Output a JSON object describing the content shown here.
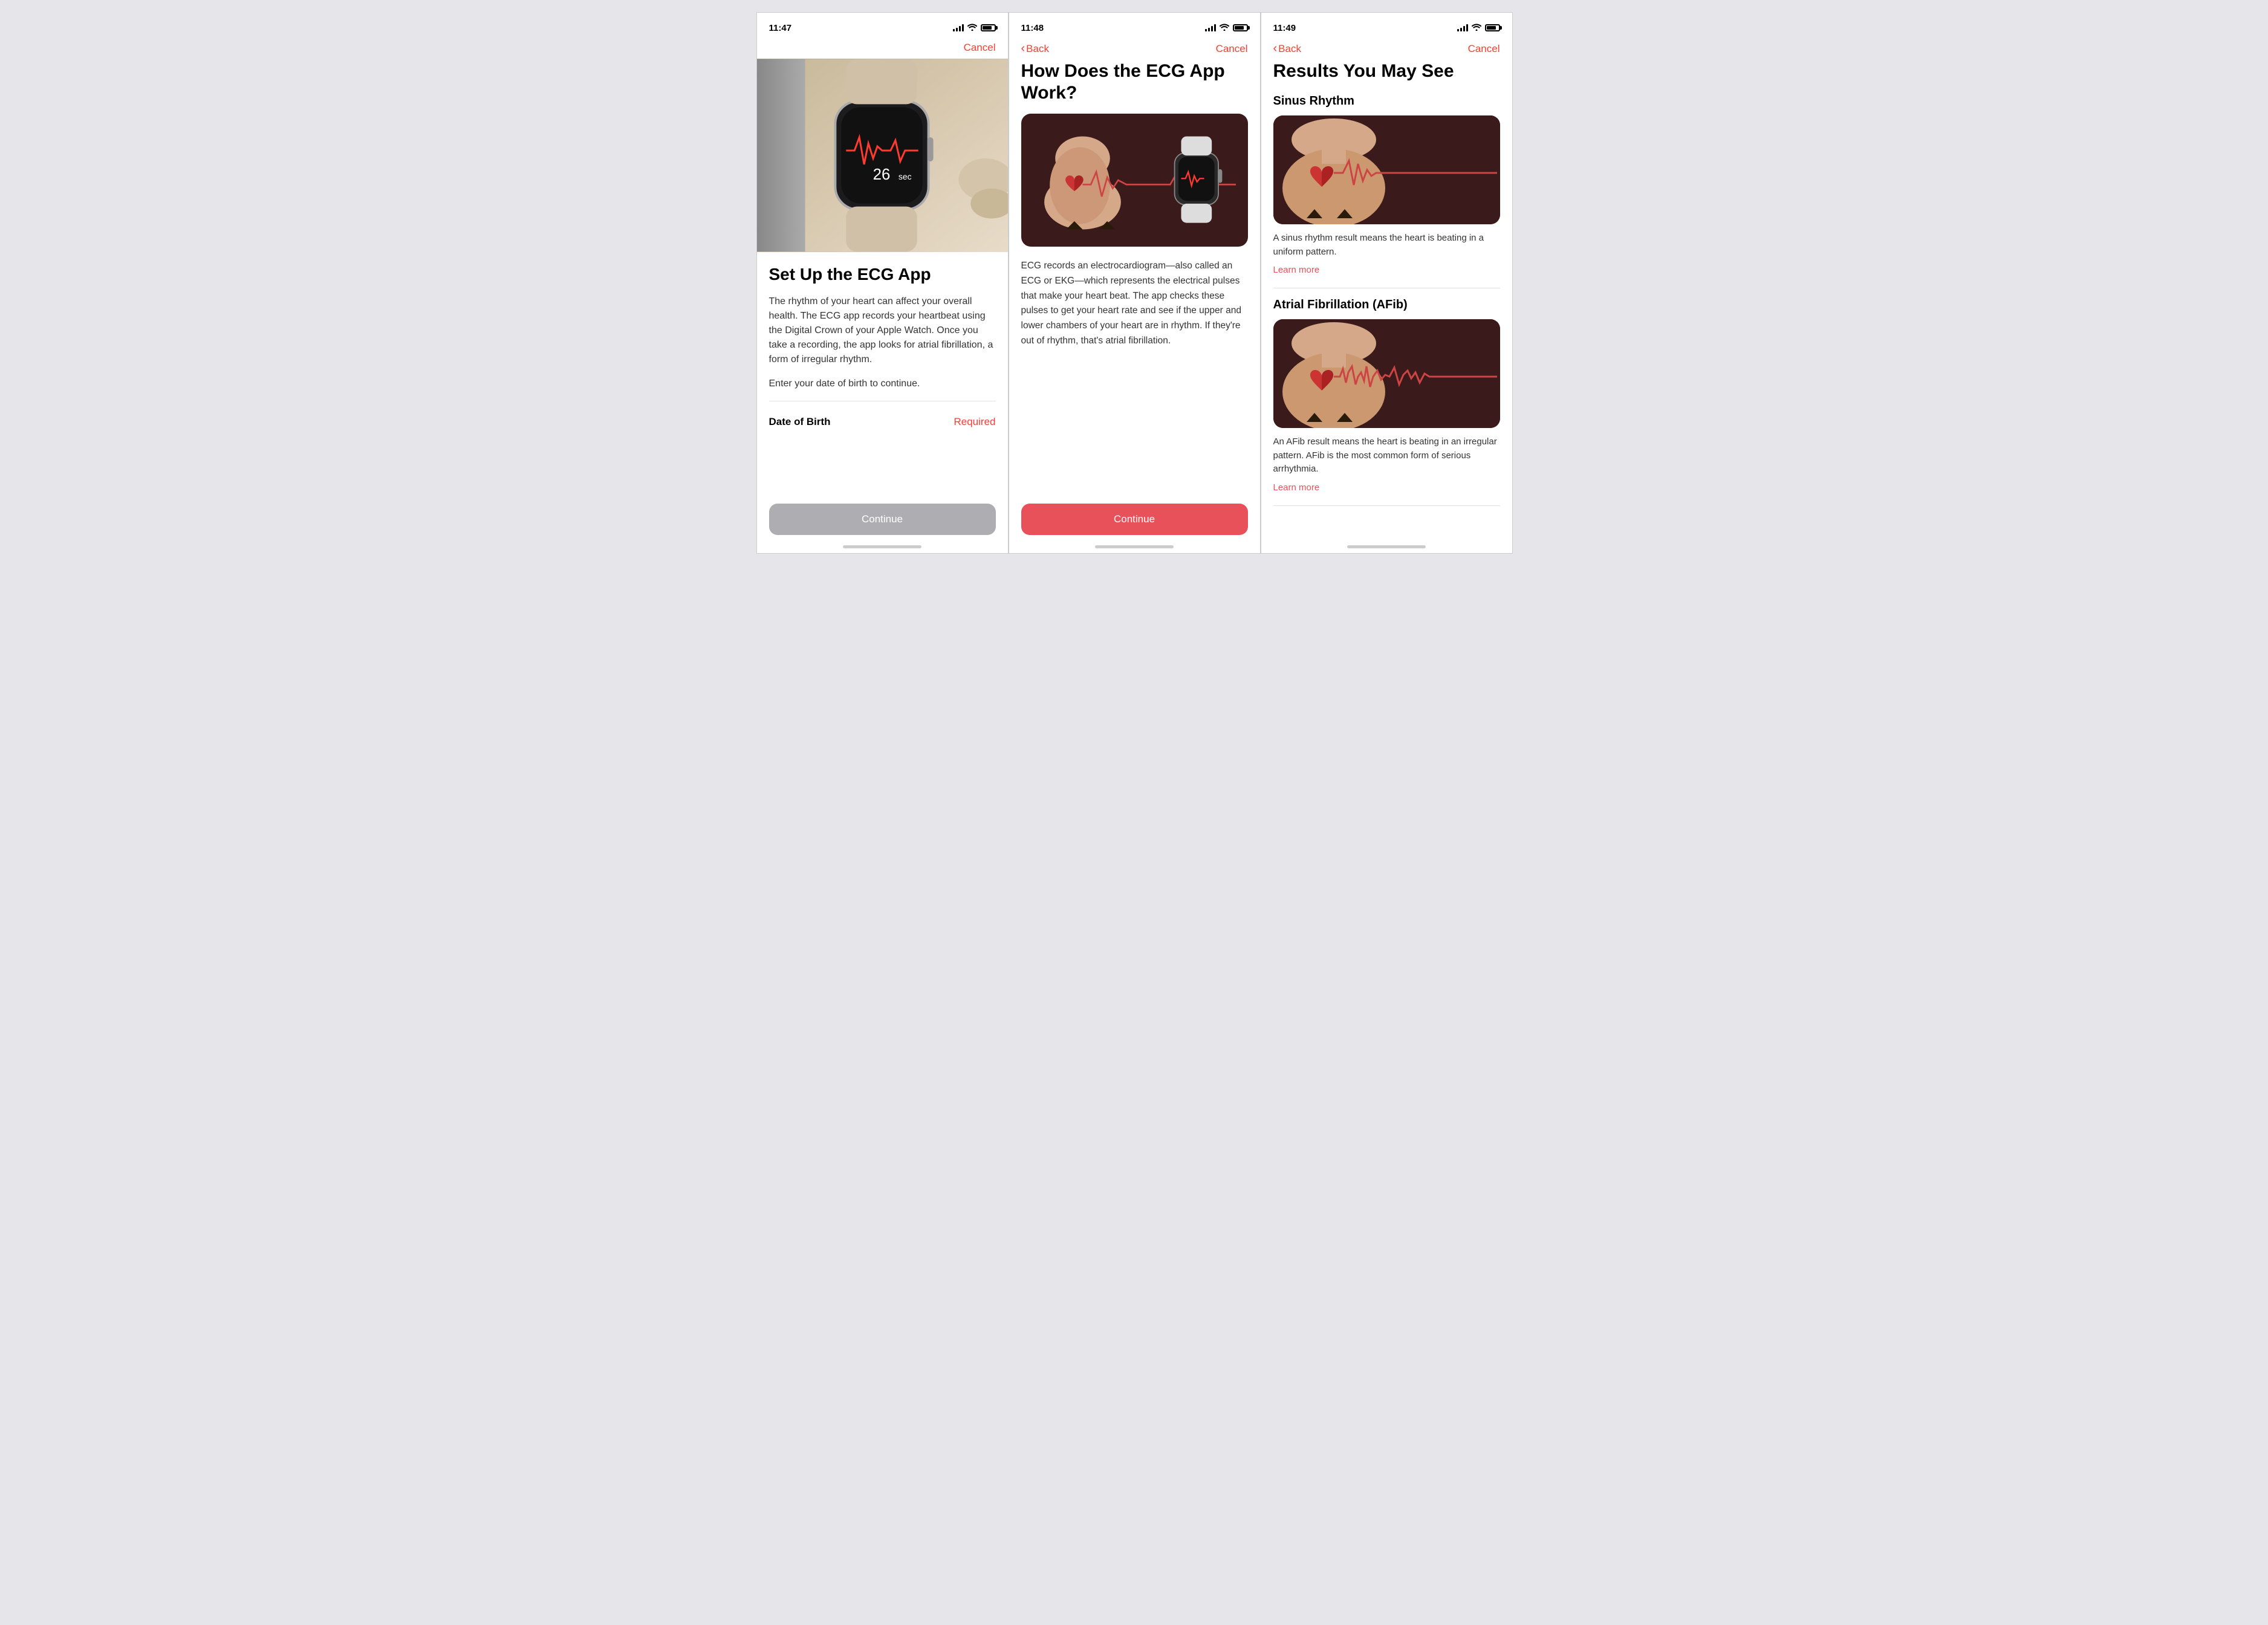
{
  "screens": [
    {
      "id": "screen1",
      "status": {
        "time": "11:47",
        "location_arrow": true
      },
      "nav": {
        "back_visible": false,
        "cancel_label": "Cancel"
      },
      "hero": {
        "timer_text": "26sec"
      },
      "title": "Set Up the ECG App",
      "body": "The rhythm of your heart can affect your overall health. The ECG app records your heartbeat using the Digital Crown of your Apple Watch. Once you take a recording, the app looks for atrial fibrillation, a form of irregular rhythm.",
      "prompt": "Enter your date of birth to continue.",
      "dob_label": "Date of Birth",
      "dob_required": "Required",
      "continue_label": "Continue",
      "continue_style": "gray"
    },
    {
      "id": "screen2",
      "status": {
        "time": "11:48",
        "location_arrow": true
      },
      "nav": {
        "back_visible": true,
        "back_label": "Back",
        "cancel_label": "Cancel"
      },
      "title": "How Does the ECG App Work?",
      "body": "ECG records an electrocardiogram—also called an ECG or EKG—which represents the electrical pulses that make your heart beat. The app checks these pulses to get your heart rate and see if the upper and lower chambers of your heart are in rhythm. If they're out of rhythm, that's atrial fibrillation.",
      "continue_label": "Continue",
      "continue_style": "red"
    },
    {
      "id": "screen3",
      "status": {
        "time": "11:49",
        "location_arrow": true
      },
      "nav": {
        "back_visible": true,
        "back_label": "Back",
        "cancel_label": "Cancel"
      },
      "title": "Results You May See",
      "results": [
        {
          "name": "Sinus Rhythm",
          "description": "A sinus rhythm result means the heart is beating in a uniform pattern.",
          "learn_more": "Learn more"
        },
        {
          "name": "Atrial Fibrillation (AFib)",
          "description": "An AFib result means the heart is beating in an irregular pattern. AFib is the most common form of serious arrhythmia.",
          "learn_more": "Learn more"
        }
      ]
    }
  ]
}
